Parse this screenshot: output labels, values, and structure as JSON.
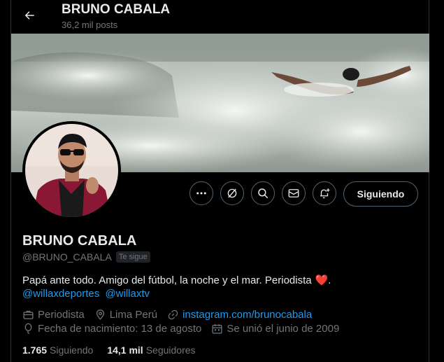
{
  "header": {
    "title": "BRUNO CABALA",
    "posts": "36,2 mil posts"
  },
  "icons": {
    "back": "arrow-left-icon",
    "more": "more-icon",
    "grok": "grok-icon",
    "search": "search-icon",
    "message": "mail-icon",
    "notify": "bell-plus-icon"
  },
  "actions": {
    "follow_label": "Siguiendo"
  },
  "profile": {
    "name": "BRUNO CABALA",
    "handle": "@BRUNO_CABALA",
    "follows_you": "Te sigue",
    "bio": "Papá ante todo. Amigo del fútbol, la noche y el mar. Periodista",
    "bio_heart": "❤️",
    "bio_end": ".",
    "mentions": [
      "@willaxdeportes",
      "@willaxtv"
    ],
    "profession": "Periodista",
    "location": "Lima Perú",
    "website": "instagram.com/brunocabala",
    "birthday": "Fecha de nacimiento: 13 de agosto",
    "joined": "Se unió el junio de 2009"
  },
  "stats": {
    "following_count": "1.765",
    "following_label": "Siguiendo",
    "followers_count": "14,1 mil",
    "followers_label": "Seguidores"
  },
  "colors": {
    "accent": "#1d9bf0",
    "muted": "#71767b",
    "border": "#2f3336",
    "heart": "#f91880"
  }
}
